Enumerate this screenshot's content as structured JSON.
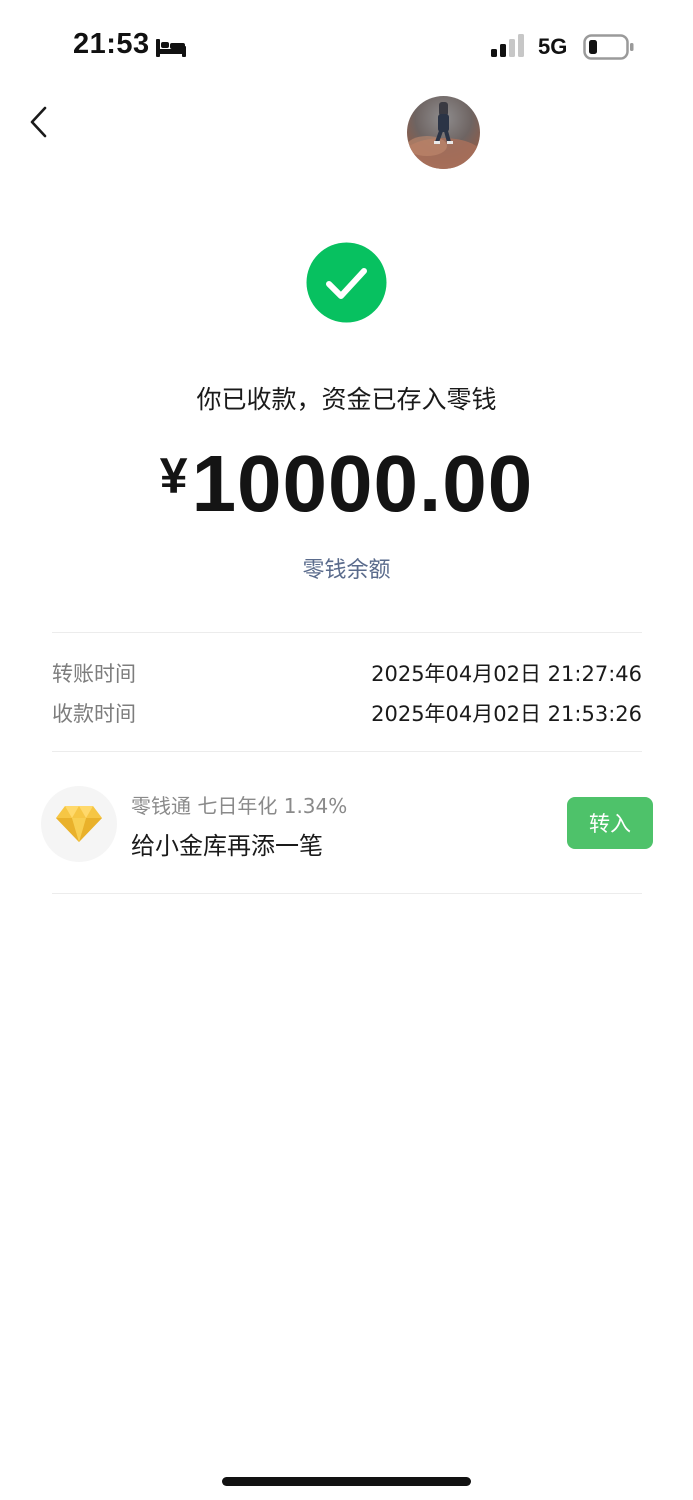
{
  "status_bar": {
    "time": "21:53",
    "network": "5G",
    "icons": [
      "sleep-focus-icon",
      "signal-icon",
      "battery-icon"
    ]
  },
  "header": {
    "back_icon": "chevron-left-icon",
    "avatar": "user-avatar"
  },
  "result": {
    "icon": "check-circle-icon",
    "message": "你已收款，资金已存入零钱",
    "currency": "¥",
    "amount": "10000.00",
    "balance_link": "零钱余额"
  },
  "details": [
    {
      "label": "转账时间",
      "value": "2025年04月02日 21:27:46"
    },
    {
      "label": "收款时间",
      "value": "2025年04月02日 21:53:26"
    }
  ],
  "promo": {
    "icon": "diamond-icon",
    "subtitle": "零钱通 七日年化 1.34%",
    "title": "给小金库再添一笔",
    "button": "转入"
  },
  "colors": {
    "success_green": "#07c160",
    "button_green": "#4ec26a",
    "link_blue": "#5a6b8c",
    "diamond_gold": "#f6c644"
  }
}
